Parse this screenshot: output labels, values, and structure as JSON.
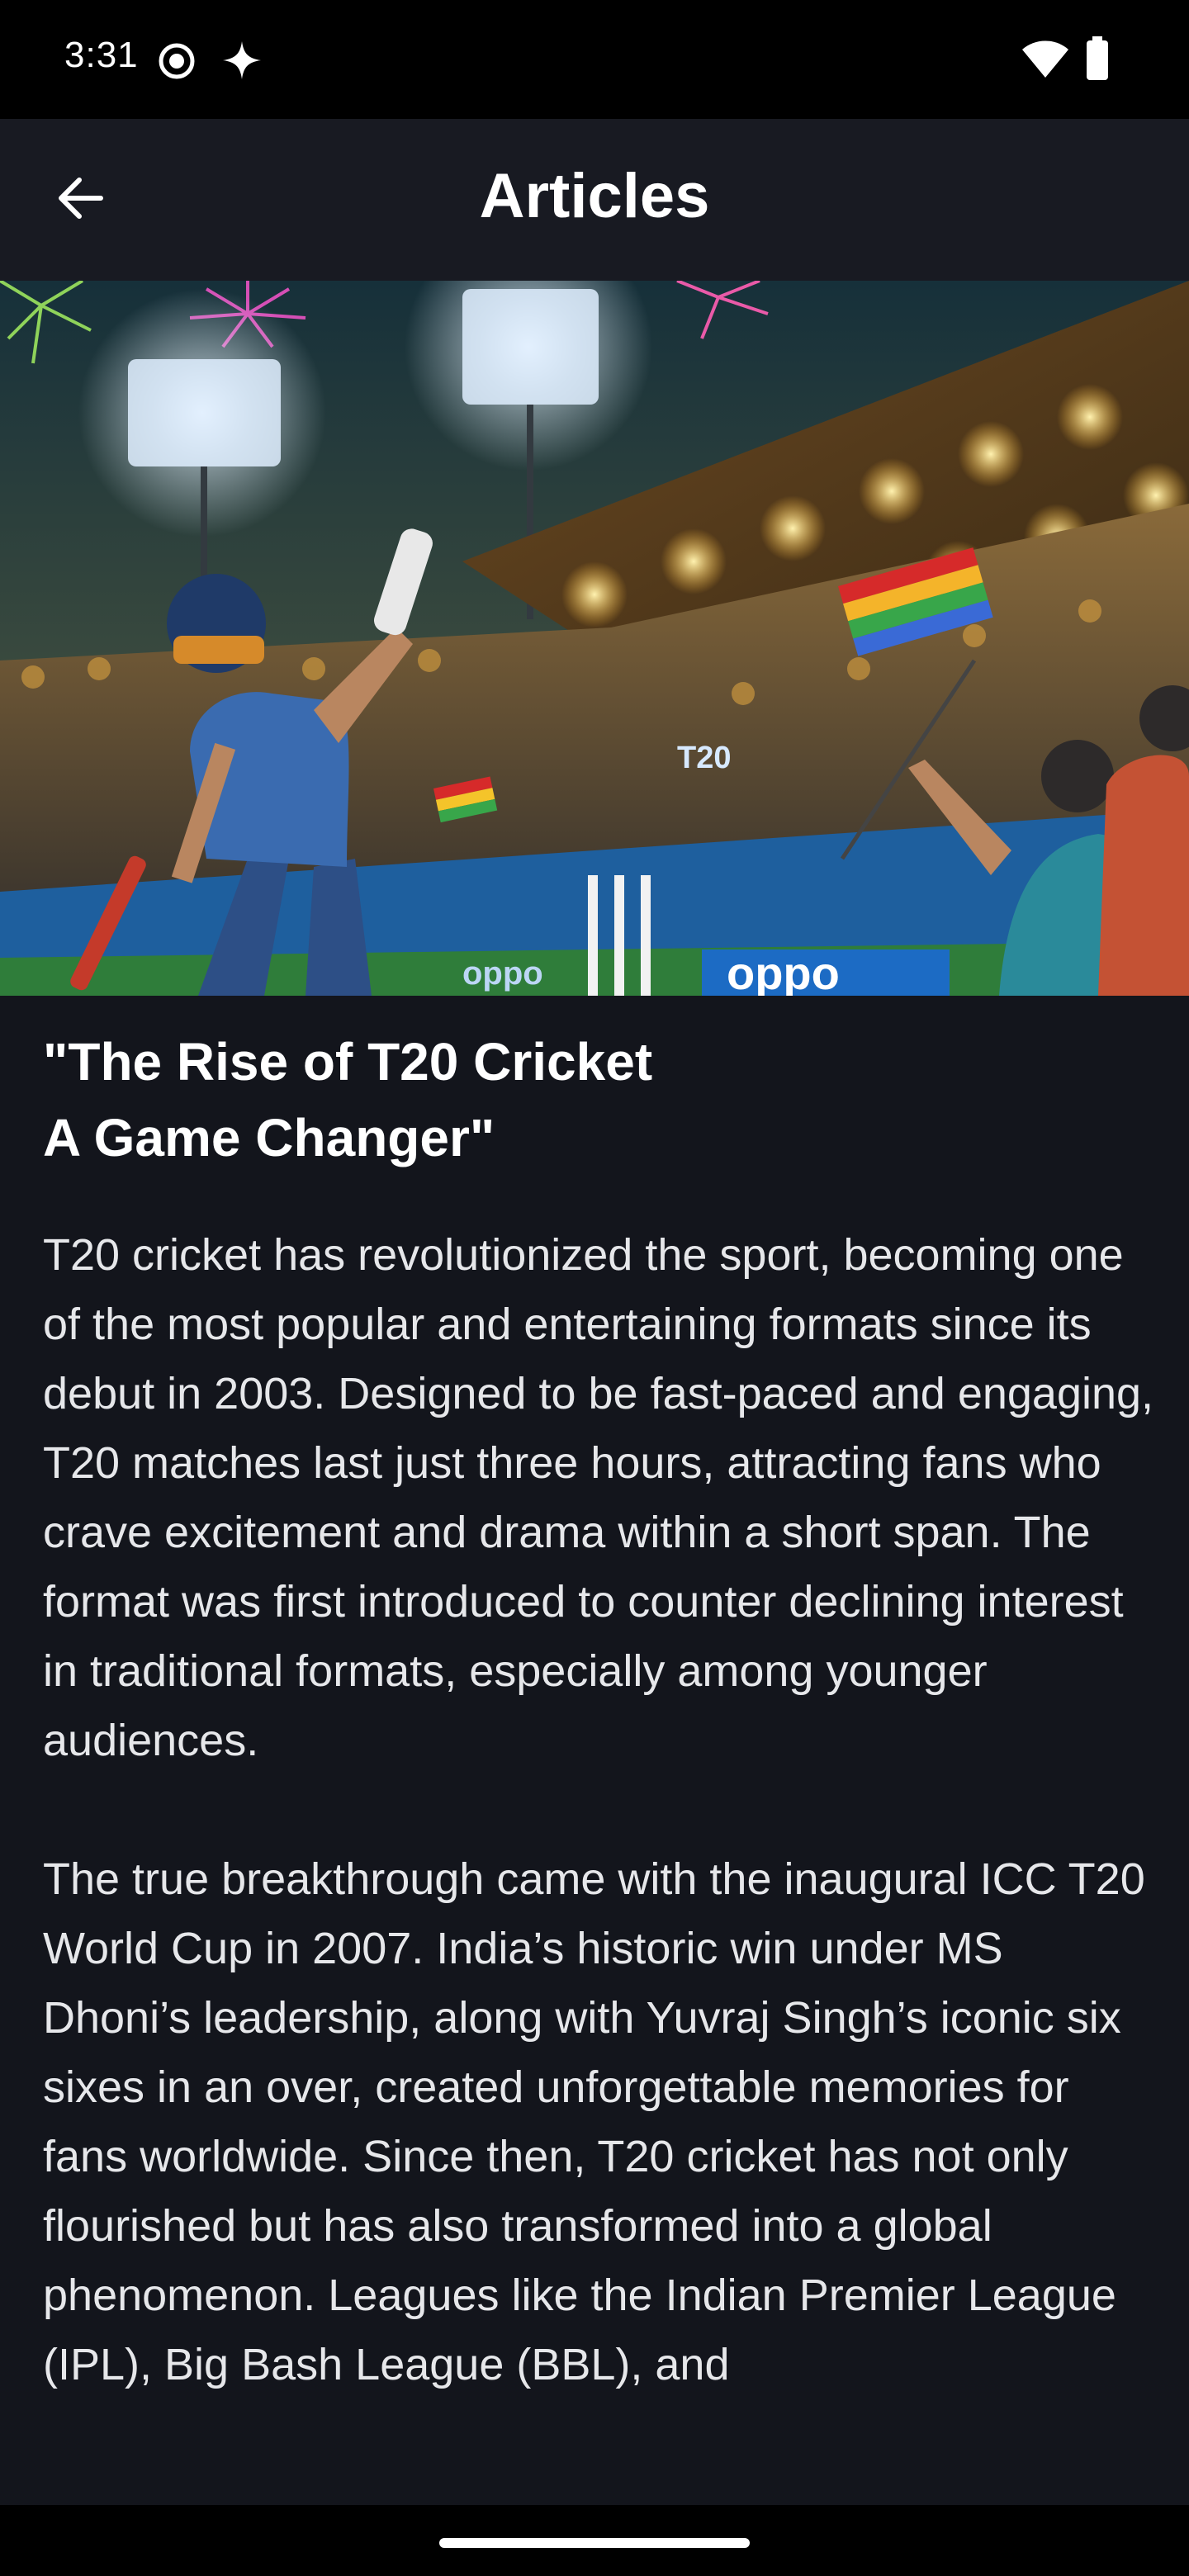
{
  "status_bar": {
    "time": "3:31",
    "icons": [
      "record-icon",
      "sparkle-icon",
      "wifi-icon",
      "battery-icon"
    ]
  },
  "app_bar": {
    "title": "Articles",
    "back_icon": "arrow-left-icon"
  },
  "hero_image": {
    "subject": "cricket-stadium-illustration",
    "banner_texts": [
      "T20",
      "oppo",
      "oppo"
    ]
  },
  "article": {
    "title": "\"The Rise of T20 Cricket\nA Game Changer\"",
    "paragraphs": [
      "T20 cricket has revolutionized the sport, becoming one of the most popular and entertaining formats since its debut in 2003. Designed to be fast-paced and engaging, T20 matches last just three hours, attracting fans who crave excitement and drama within a short span. The format was first introduced to counter declining interest in traditional formats, especially among younger audiences.",
      "The true breakthrough came with the inaugural ICC T20 World Cup in 2007. India’s historic win under MS Dhoni’s leadership, along with Yuvraj Singh’s iconic six sixes in an over, created unforgettable memories for fans worldwide. Since then, T20 cricket has not only flourished but has also transformed into a global phenomenon. Leagues like the Indian Premier League (IPL), Big Bash League (BBL), and"
    ]
  },
  "colors": {
    "background": "#13151c",
    "app_bar": "#181a22",
    "status_bar": "#000000",
    "text_primary": "#ffffff"
  }
}
